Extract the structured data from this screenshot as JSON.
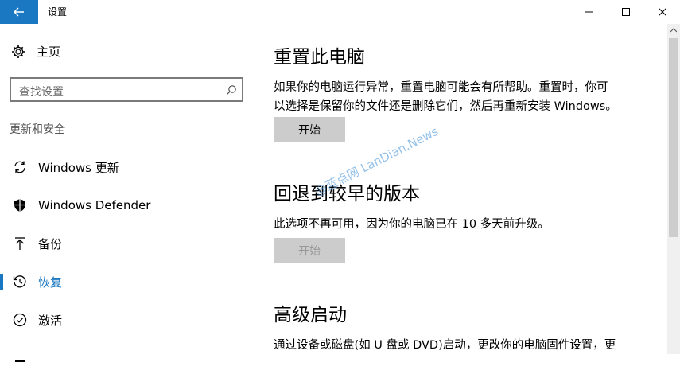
{
  "window": {
    "title": "设置"
  },
  "sidebar": {
    "home_label": "主页",
    "search_placeholder": "查找设置",
    "section_label": "更新和安全",
    "items": [
      {
        "label": "Windows 更新",
        "icon": "sync-icon"
      },
      {
        "label": "Windows Defender",
        "icon": "shield-icon"
      },
      {
        "label": "备份",
        "icon": "backup-arrow-icon"
      },
      {
        "label": "恢复",
        "icon": "history-icon",
        "active": true
      },
      {
        "label": "激活",
        "icon": "check-circle-icon"
      }
    ]
  },
  "main": {
    "reset": {
      "title": "重置此电脑",
      "description_line1": "如果你的电脑运行异常，重置电脑可能会有所帮助。重置时，你可",
      "description_line2": "以选择是保留你的文件还是删除它们，然后再重新安装 Windows。",
      "button_label": "开始"
    },
    "rollback": {
      "title": "回退到较早的版本",
      "description": "此选项不再可用，因为你的电脑已在 10 多天前升级。",
      "button_label": "开始"
    },
    "advanced": {
      "title": "高级启动",
      "description": "通过设备或磁盘(如 U 盘或 DVD)启动，更改你的电脑固件设置，更"
    }
  },
  "watermark": "@蓝点网 LanDian.News",
  "colors": {
    "accent": "#1a78c2",
    "button": "#cccccc"
  }
}
